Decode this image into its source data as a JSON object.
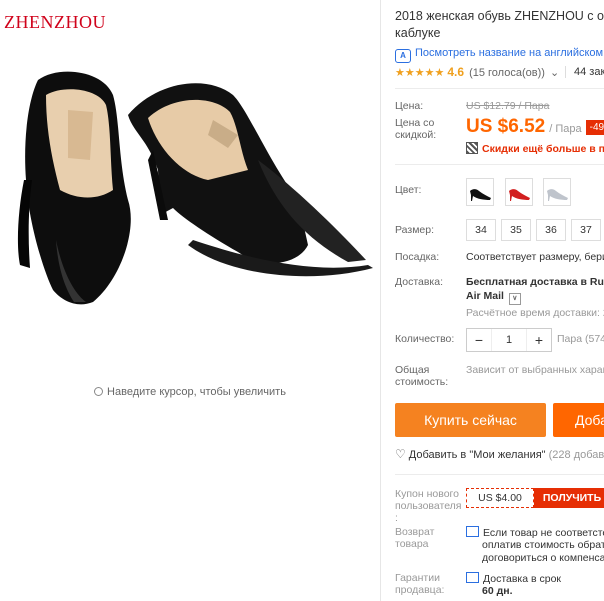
{
  "store": {
    "brand": "ZHENZHOU"
  },
  "image": {
    "zoom_hint": "Наведите курсор, чтобы увеличить"
  },
  "product": {
    "title_line1": "2018 женская обувь ZHENZHOU с ос",
    "title_line2": "каблуке",
    "translate_label": "Посмотреть название на английском",
    "rating": "4.6",
    "votes": "(15 голоса(ов))",
    "votes_chevron": "⌄",
    "orders": "44 зака"
  },
  "price": {
    "label": "Цена:",
    "old": "US $12.79 / Пара",
    "discount_label": "Цена со скидкой:",
    "new": "US $6.52",
    "unit": "/ Пара",
    "discount": "-49",
    "qr_text": "Скидки ещё больше в при"
  },
  "color": {
    "label": "Цвет:",
    "options": [
      "black",
      "red",
      "silver"
    ]
  },
  "size": {
    "label": "Размер:",
    "options": [
      "34",
      "35",
      "36",
      "37"
    ]
  },
  "fit": {
    "label": "Посадка:",
    "value": "Соответствует размеру, бери"
  },
  "shipping": {
    "label": "Доставка:",
    "line1": "Бесплатная доставка в Rus",
    "line2": "Air Mail",
    "time": "Расчётное время доставки: 2"
  },
  "quantity": {
    "label": "Количество:",
    "minus": "−",
    "value": "1",
    "plus": "+",
    "unit_info": "Пара (574"
  },
  "total": {
    "label_line1": "Общая",
    "label_line2": "стоимость:",
    "value": "Зависит от выбранных харак"
  },
  "actions": {
    "buy": "Купить сейчас",
    "cart": "Доба",
    "wishlist": "Добавить в \"Мои желания\"",
    "wishlist_count": "(228 добавл"
  },
  "coupon": {
    "label_line1": "Купон нового",
    "label_line2": "пользователя",
    "label_line3": ":",
    "value": "US $4.00",
    "get": "ПОЛУЧИТЬ"
  },
  "returns": {
    "label_line1": "Возврат",
    "label_line2": "товара",
    "line1": "Если товар не соответсте",
    "line2": "оплатив стоимость обрат",
    "line3": "договориться о компенса"
  },
  "guarantee": {
    "label_line1": "Гарантии",
    "label_line2": "продавца:",
    "line1": "Доставка в срок",
    "line2": "60 дн."
  },
  "colors": {
    "accent": "#f60",
    "red": "#e62e04",
    "link": "#2b6fe0",
    "star": "#f0a01e"
  }
}
